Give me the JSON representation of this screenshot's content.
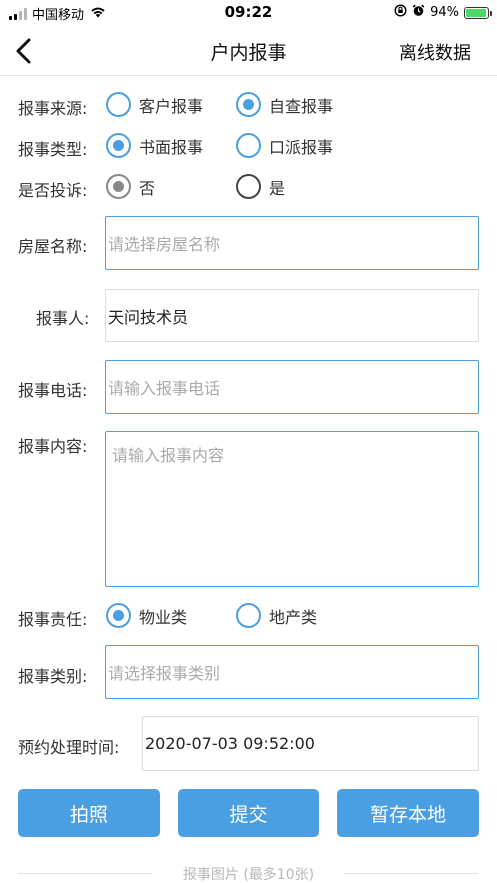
{
  "status_bar": {
    "carrier": "中国移动",
    "time": "09:22",
    "battery_percent": "94%",
    "battery_level": 0.94
  },
  "nav": {
    "title": "户内报事",
    "right_action": "离线数据"
  },
  "form": {
    "source": {
      "label": "报事来源:",
      "options": [
        "客户报事",
        "自查报事"
      ],
      "selected": 1
    },
    "type": {
      "label": "报事类型:",
      "options": [
        "书面报事",
        "口派报事"
      ],
      "selected": 0
    },
    "complaint": {
      "label": "是否投诉:",
      "options": [
        "否",
        "是"
      ],
      "selected": 0
    },
    "house_name": {
      "label": "房屋名称:",
      "placeholder": "请选择房屋名称"
    },
    "reporter": {
      "label": "报事人:",
      "value": "天问技术员"
    },
    "phone": {
      "label": "报事电话:",
      "placeholder": "请输入报事电话"
    },
    "content": {
      "label": "报事内容:",
      "placeholder": "请输入报事内容"
    },
    "responsibility": {
      "label": "报事责任:",
      "options": [
        "物业类",
        "地产类"
      ],
      "selected": 0
    },
    "category": {
      "label": "报事类别:",
      "placeholder": "请选择报事类别"
    },
    "appointment": {
      "label": "预约处理时间:",
      "value": "2020-07-03 09:52:00"
    }
  },
  "buttons": {
    "photo": "拍照",
    "submit": "提交",
    "save_local": "暂存本地"
  },
  "photos_section": {
    "label": "报事图片 (最多10张)"
  },
  "colors": {
    "accent": "#4a9fe3"
  }
}
